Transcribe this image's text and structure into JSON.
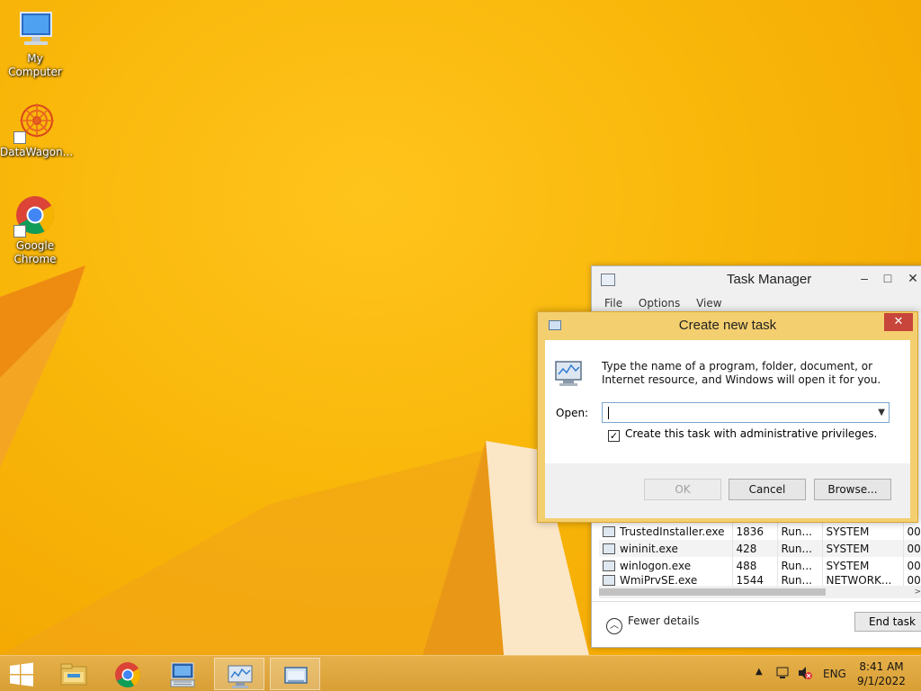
{
  "desktop": {
    "icons": [
      {
        "label": "My Computer",
        "icon": "computer-icon"
      },
      {
        "label": "DataWagon...",
        "icon": "datawagon-icon"
      },
      {
        "label": "Google Chrome",
        "icon": "chrome-icon"
      }
    ]
  },
  "task_manager": {
    "title": "Task Manager",
    "menu": [
      "File",
      "Options",
      "View"
    ],
    "processes": [
      {
        "name": "TrustedInstaller.exe",
        "pid": "1836",
        "status": "Run...",
        "user": "SYSTEM",
        "cpu": "00"
      },
      {
        "name": "wininit.exe",
        "pid": "428",
        "status": "Run...",
        "user": "SYSTEM",
        "cpu": "00"
      },
      {
        "name": "winlogon.exe",
        "pid": "488",
        "status": "Run...",
        "user": "SYSTEM",
        "cpu": "00"
      },
      {
        "name": "WmiPrvSE.exe",
        "pid": "1544",
        "status": "Run...",
        "user": "NETWORK...",
        "cpu": "00"
      }
    ],
    "fewer_details": "Fewer details",
    "end_task": "End task"
  },
  "dialog": {
    "title": "Create new task",
    "description": "Type the name of a program, folder, document, or Internet resource, and Windows will open it for you.",
    "open_label": "Open:",
    "open_value": "",
    "admin_checkbox_label": "Create this task with administrative privileges.",
    "admin_checked": true,
    "ok": "OK",
    "cancel": "Cancel",
    "browse": "Browse...",
    "close": "✕"
  },
  "taskbar": {
    "items": [
      "start-icon",
      "file-explorer-icon",
      "chrome-icon",
      "rdp-icon",
      "task-manager-icon",
      "run-dialog-icon"
    ],
    "tray": {
      "language": "ENG",
      "time": "8:41 AM",
      "date": "9/1/2022"
    }
  },
  "colors": {
    "desktop": "#f6b800",
    "taskbar": "#dea53c",
    "dialog_frame": "#f4cf6f",
    "close_button": "#c7453a"
  }
}
